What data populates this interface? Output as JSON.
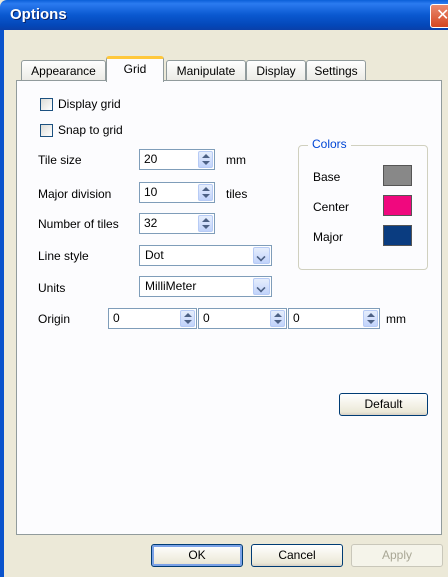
{
  "window": {
    "title": "Options"
  },
  "tabs": [
    "Appearance",
    "Grid",
    "Manipulate",
    "Display",
    "Settings"
  ],
  "grid": {
    "display_grid_label": "Display grid",
    "display_grid_checked": false,
    "snap_to_grid_label": "Snap to grid",
    "snap_to_grid_checked": false,
    "tile_size_label": "Tile size",
    "tile_size_value": "20",
    "tile_size_unit": "mm",
    "major_division_label": "Major division",
    "major_division_value": "10",
    "major_division_unit": "tiles",
    "number_of_tiles_label": "Number of tiles",
    "number_of_tiles_value": "32",
    "line_style_label": "Line style",
    "line_style_value": "Dot",
    "units_label": "Units",
    "units_value": "MilliMeter",
    "origin_label": "Origin",
    "origin_x": "0",
    "origin_y": "0",
    "origin_z": "0",
    "origin_unit": "mm"
  },
  "colors": {
    "title": "Colors",
    "base_label": "Base",
    "base_color": "#888888",
    "center_label": "Center",
    "center_color": "#f0087e",
    "major_label": "Major",
    "major_color": "#0a3c80"
  },
  "buttons": {
    "default": "Default",
    "ok": "OK",
    "cancel": "Cancel",
    "apply": "Apply"
  }
}
